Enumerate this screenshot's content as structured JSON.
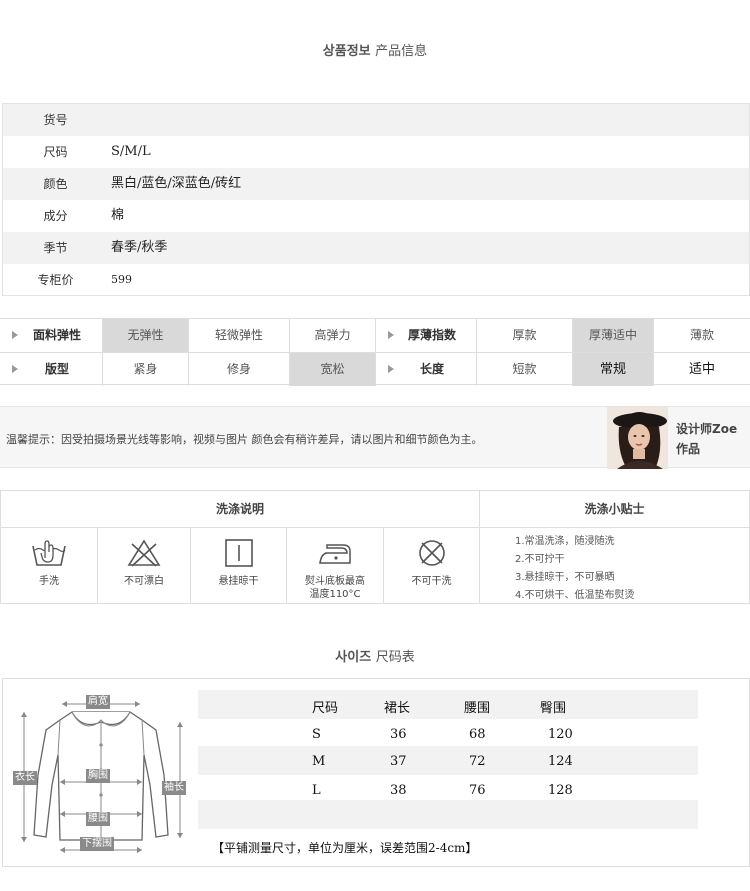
{
  "product_info": {
    "title_ko": "상품정보",
    "title_cn": "产品信息",
    "rows": [
      {
        "key": "货号",
        "value": ""
      },
      {
        "key": "尺码",
        "value": "S/M/L"
      },
      {
        "key": "颜色",
        "value": "黑白/蓝色/深蓝色/砖红"
      },
      {
        "key": "成分",
        "value": "棉"
      },
      {
        "key": "季节",
        "value": "春季/秋季"
      },
      {
        "key": "专柜价",
        "value": "599"
      }
    ]
  },
  "attributes": {
    "row1": {
      "label_a": "面料弹性",
      "opts_a": [
        "无弹性",
        "轻微弹性",
        "高弹力"
      ],
      "label_b": "厚薄指数",
      "opts_b": [
        "厚款",
        "厚薄适中",
        "薄款"
      ]
    },
    "row2": {
      "label_a": "版型",
      "opts_a": [
        "紧身",
        "修身",
        "宽松"
      ],
      "label_b": "长度",
      "opts_b": [
        "短款",
        "常规",
        "适中"
      ]
    }
  },
  "note": {
    "text": "温馨提示：因受拍摄场景光线等影响，视频与图片 颜色会有稍许差异，请以图片和细节颜色为主。",
    "designer_line1": "设计师Zoe",
    "designer_line2": "作品"
  },
  "wash": {
    "head_left": "洗涤说明",
    "head_right": "洗涤小贴士",
    "icons": [
      {
        "icon": "hand-wash-icon",
        "label": "手洗"
      },
      {
        "icon": "no-bleach-icon",
        "label": "不可漂白"
      },
      {
        "icon": "hang-dry-icon",
        "label": "悬挂晾干"
      },
      {
        "icon": "iron-icon",
        "label": "熨斗底板最高",
        "label2": "温度110°C"
      },
      {
        "icon": "no-dry-clean-icon",
        "label": "不可干洗"
      }
    ],
    "tips": [
      "1.常温洗涤，随浸随洗",
      "2.不可拧干",
      "3.悬挂晾干，不可暴晒",
      "4.不可烘干、低温垫布熨烫"
    ]
  },
  "size": {
    "title_ko": "사이즈",
    "title_cn": "尺码表",
    "headers": [
      "尺码",
      "裙长",
      "腰围",
      "臀围"
    ],
    "rows": [
      [
        "S",
        "36",
        "68",
        "120"
      ],
      [
        "M",
        "37",
        "72",
        "124"
      ],
      [
        "L",
        "38",
        "76",
        "128"
      ]
    ],
    "note": "【平铺测量尺寸，单位为厘米，误差范围2-4cm】",
    "diagram_labels": {
      "shoulder": "肩宽",
      "length": "衣长",
      "sleeve": "袖长",
      "chest": "胸围",
      "waist": "腰围",
      "hem": "下摆围"
    }
  },
  "colors": {
    "highlight": "#d9d9d9",
    "band": "#f2f2f2",
    "border": "#dddddd"
  }
}
